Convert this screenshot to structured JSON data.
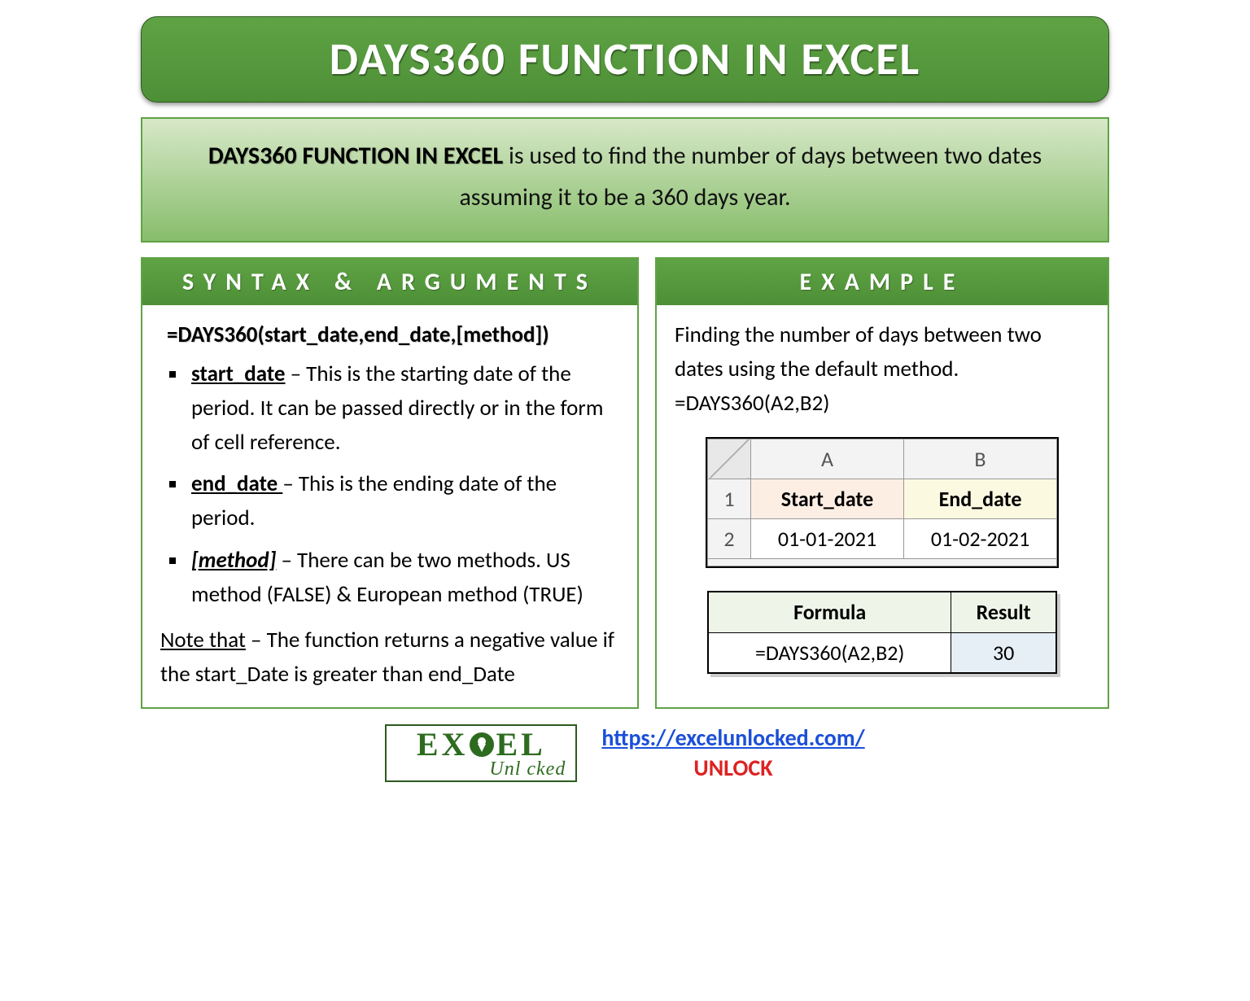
{
  "title": "DAYS360 FUNCTION IN EXCEL",
  "description": {
    "lead": "DAYS360 FUNCTION IN EXCEL",
    "rest": " is used to find the number of days between two dates assuming it to be a 360 days year."
  },
  "syntax": {
    "header": "SYNTAX & ARGUMENTS",
    "formula": "=DAYS360(start_date,end_date,[method])",
    "args": [
      {
        "name": "start_date",
        "italic": false,
        "desc": " – This is the starting date of the period. It can be passed directly or in the form of cell reference."
      },
      {
        "name": "end_date ",
        "italic": false,
        "desc": "– This is the ending date of the period."
      },
      {
        "name": "[method]",
        "italic": true,
        "desc": " – There can be two methods. US method (FALSE) & European method (TRUE)"
      }
    ],
    "note_label": "Note that",
    "note_text": " – The function returns a negative value if the start_Date is greater than end_Date"
  },
  "example": {
    "header": "EXAMPLE",
    "text": "Finding the number of days between two dates using the default method.",
    "formula": "=DAYS360(A2,B2)",
    "sheet": {
      "colA": "A",
      "colB": "B",
      "row1": "1",
      "row2": "2",
      "h_start": "Start_date",
      "h_end": "End_date",
      "valA": "01-01-2021",
      "valB": "01-02-2021"
    },
    "result": {
      "h1": "Formula",
      "h2": "Result",
      "f": "=DAYS360(A2,B2)",
      "r": "30"
    }
  },
  "footer": {
    "logo_top_left": "EX",
    "logo_top_right": "EL",
    "logo_bottom": "Unl   cked",
    "url": "https://excelunlocked.com/",
    "unlock": "UNLOCK"
  }
}
